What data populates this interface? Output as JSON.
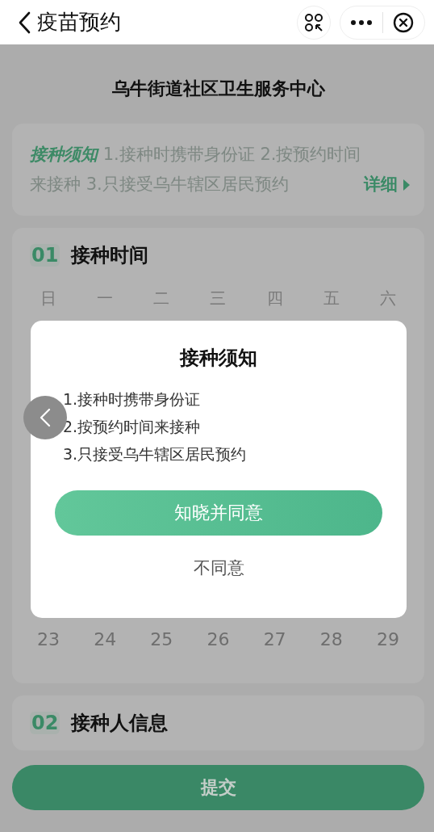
{
  "header": {
    "title": "疫苗预约"
  },
  "center_name": "乌牛街道社区卫生服务中心",
  "notice": {
    "label": "接种须知",
    "text": "1.接种时携带身份证 2.按预约时间来接种 3.只接受乌牛辖区居民预约",
    "link": "详细"
  },
  "sections": [
    {
      "kind": "calendar",
      "number": "01",
      "title": "接种时间",
      "weekdays": [
        "日",
        "一",
        "二",
        "三",
        "四",
        "五",
        "六"
      ],
      "dates": [
        "23",
        "24",
        "25",
        "26",
        "27",
        "28",
        "29"
      ]
    },
    {
      "kind": "info",
      "number": "02",
      "title": "接种人信息"
    }
  ],
  "submit": "提交",
  "dialog": {
    "title": "接种须知",
    "items": [
      "1.接种时携带身份证",
      "2.按预约时间来接种",
      "3.只接受乌牛辖区居民预约"
    ],
    "confirm": "知晓并同意",
    "cancel": "不同意"
  }
}
